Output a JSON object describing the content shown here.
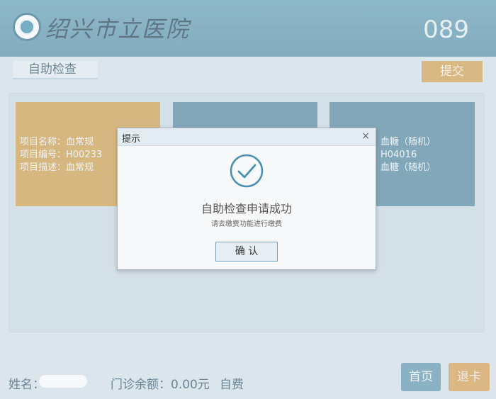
{
  "header": {
    "hospital_name": "绍兴市立医院",
    "queue_number": "089"
  },
  "toolbar": {
    "page_title": "自助检查",
    "submit_label": "提交"
  },
  "cards": [
    {
      "lines": [
        "项目名称：血常规",
        "项目编号：H00233",
        "项目描述：血常规"
      ]
    },
    {
      "lines": [
        "",
        "",
        ""
      ]
    },
    {
      "lines": [
        "血糖（随机）",
        "H04016",
        "血糖（随机）"
      ]
    }
  ],
  "footer": {
    "name_label": "姓名：",
    "balance_label": "门诊余额：0.00元",
    "payment_type": "自费",
    "home_label": "首页",
    "exit_label": "退卡"
  },
  "dialog": {
    "title": "提示",
    "close": "×",
    "message": "自助检查申请成功",
    "sub_message": "请去缴费功能进行缴费",
    "confirm_label": "确 认"
  },
  "colors": {
    "accent_orange": "#d29c48",
    "accent_blue": "#4d829a",
    "header_blue": "#5f9cb2"
  }
}
